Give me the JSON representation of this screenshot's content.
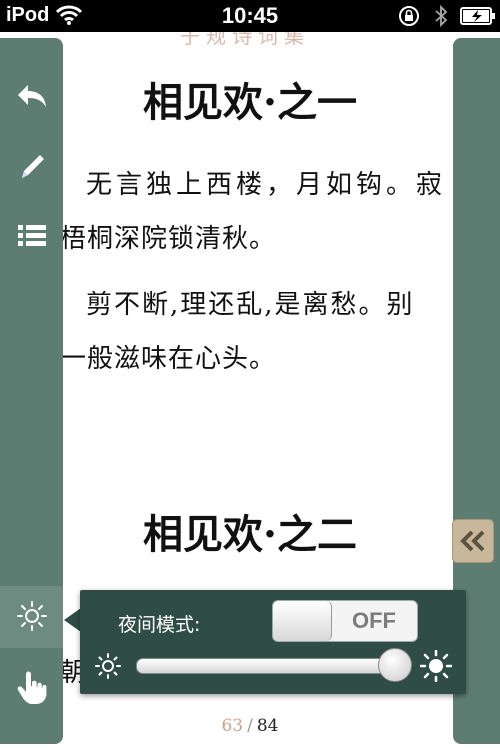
{
  "status_bar": {
    "carrier": "iPod",
    "time": "10:45"
  },
  "page": {
    "faded_top_text": "子规诗词集",
    "heading_1": "相见欢·之一",
    "para1_line1": "无言独上西楼，月如钩。寂",
    "para1_line2": "梧桐深院锁清秋。",
    "para2_line1": "剪不断,理还乱,是离愁。别",
    "para2_line2": "一般滋味在心头。",
    "heading_2": "相见欢·之二",
    "para3_line1": "朝"
  },
  "pagination": {
    "current": "63",
    "separator": "/",
    "total": "84"
  },
  "toolbar_icons": [
    "back-arrow-icon",
    "pen-icon",
    "list-icon",
    "brightness-icon",
    "hand-icon"
  ],
  "brightness_popover": {
    "night_mode_label": "夜间模式:",
    "night_mode_toggle": "OFF",
    "brightness_level": 0.95
  },
  "colors": {
    "toolbar": "#5e7d72",
    "popover": "#2f4d44",
    "collapse_button": "#c8b79a",
    "page_number": "#c9a48e"
  }
}
